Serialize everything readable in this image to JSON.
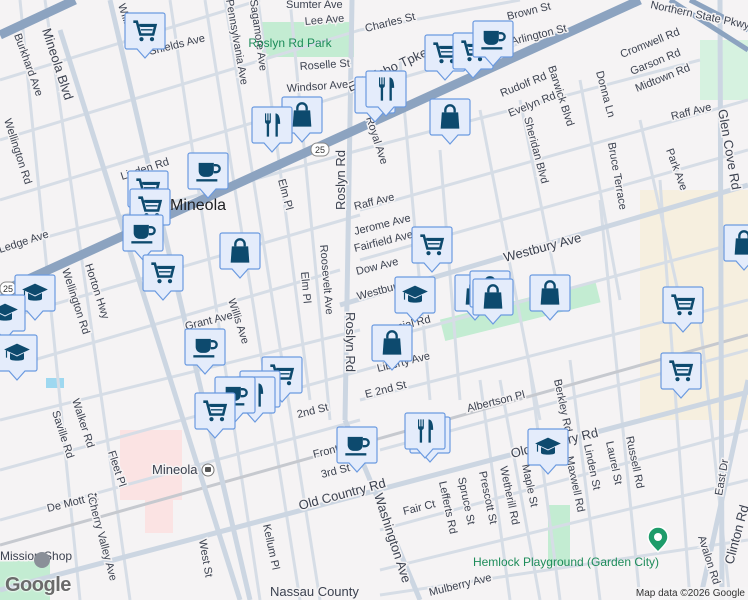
{
  "map": {
    "place_label": "Mineola",
    "station_label": "Mineola",
    "route_shield": "25",
    "parks": [
      "Roslyn Rd Park",
      "Hemlock Playground (Garden City)"
    ],
    "poi_partial": "Mission Shop",
    "building_label": "Nassau County",
    "attribution": "Map data ©2026 Google",
    "logo": "Google",
    "streets": {
      "jericho": "E Jericho Tpke",
      "old_country": "Old Country Rd",
      "westbury": "Westbury Ave",
      "willis": "Willis Ave",
      "mineola_blvd": "Mineola Blvd",
      "roslyn": "Roslyn Rd",
      "washington": "Washington Ave",
      "glen_cove": "Glen Cove Rd",
      "clinton": "Clinton Rd",
      "burkhard": "Burkhard Ave",
      "wellington": "Wellington Rd",
      "horton": "Horton Hwy",
      "linden_rd": "Linden Rd",
      "sumter": "Sumter Ave",
      "lee": "Lee Ave",
      "shields": "Shields Ave",
      "roselle": "Roselle St",
      "windsor": "Windsor Ave",
      "charles": "Charles St",
      "brown": "Brown St",
      "arlington": "Arlington St",
      "cromwell": "Cromwell Rd",
      "garson": "Garson Rd",
      "midtown": "Midtown Rd",
      "rudolf": "Rudolf Rd",
      "evelyn": "Evelyn Rd",
      "barwick": "Barwick Blvd",
      "donna": "Donna Ln",
      "sheridan": "Sheridan Blvd",
      "bruce": "Bruce Terrace",
      "park_ave": "Park Ave",
      "raff": "Raff Ave",
      "jerome": "Jerome Ave",
      "fairfield": "Fairfield Ave",
      "dow": "Dow Ave",
      "royal": "Royal Ave",
      "elm": "Elm Pl",
      "roosevelt": "Roosevelt Ave",
      "sagamore": "Sagamore Ave",
      "pennsylvania": "Pennsylvania Ave",
      "grant": "Grant Ave",
      "second": "2nd St",
      "e_second": "E 2nd St",
      "albertson": "Albertson Pl",
      "front": "Front St",
      "third": "3rd St",
      "saville": "Saville Rd",
      "walker": "Walker Rd",
      "fleet": "Fleet Pl",
      "de_mott": "De Mott St",
      "west": "West St",
      "kellum": "Kellum Pl",
      "cherry": "Cherry Valley Ave",
      "fair_ct": "Fair Ct",
      "lefferts": "Lefferts Rd",
      "spruce": "Spruce St",
      "prescott": "Prescott St",
      "wetherill": "Wetherill Rd",
      "maple": "Maple St",
      "maxwell": "Maxwell Rd",
      "berkley": "Berkley Rd",
      "linden_st": "Linden St",
      "laurel": "Laurel St",
      "russell": "Russell Rd",
      "east_dr": "East Dr",
      "avalon": "Avalon Rd",
      "mulberry": "Mulberry Ave",
      "colonial": "Colonial Rd",
      "liberty": "Liberty Ave",
      "ledge": "Ledge Ave",
      "pkwy": "Northern State Pkwy"
    },
    "marker_types": [
      "grocery",
      "grocery",
      "grocery",
      "cafe",
      "restaurant",
      "restaurant",
      "shopping",
      "restaurant",
      "cafe",
      "grocery",
      "grocery",
      "cafe",
      "shopping",
      "grocery",
      "school",
      "school",
      "school",
      "shopping",
      "grocery",
      "school",
      "shopping",
      "shopping",
      "shopping",
      "shopping",
      "grocery",
      "grocery",
      "shopping",
      "cafe",
      "grocery",
      "restaurant",
      "restaurant",
      "cafe",
      "grocery",
      "cafe",
      "restaurant",
      "restaurant",
      "school",
      "shopping"
    ],
    "colors": {
      "marker_fill": "#e4ecfb",
      "marker_border": "#6b9ae0",
      "icon": "#0d4a6e",
      "highway": "#8ca3c0",
      "land": "#f5f3f4",
      "park": "#c3ecd2"
    }
  }
}
